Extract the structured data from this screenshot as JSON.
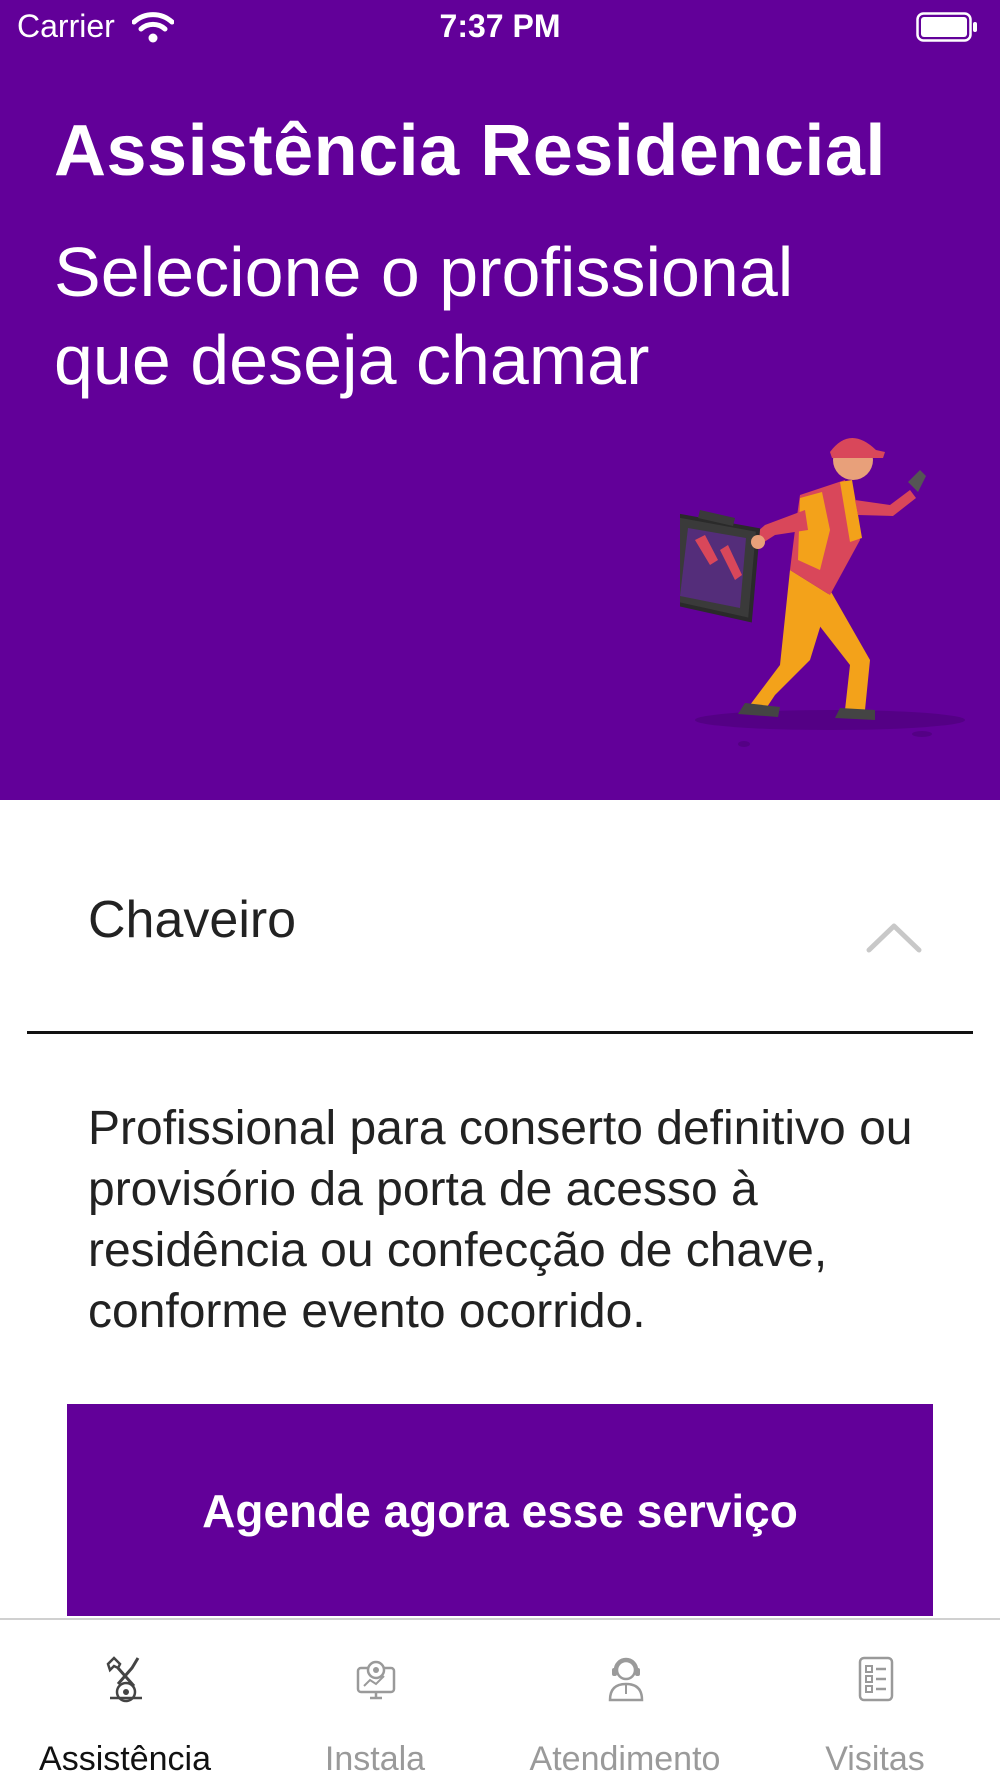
{
  "status_bar": {
    "carrier": "Carrier",
    "time": "7:37 PM"
  },
  "hero": {
    "title": "Assistência Residencial",
    "subtitle": "Selecione o profissional que deseja chamar",
    "illustration": "running-repairman-with-toolbox"
  },
  "service": {
    "name": "Chaveiro",
    "expanded": true,
    "description": "Profissional para conserto definitivo ou provisório da porta de acesso à residência ou confecção de chave, conforme evento ocorrido.",
    "cta_label": "Agende agora esse serviço"
  },
  "tabs": [
    {
      "label": "Assistência",
      "icon": "repair-tools-icon",
      "active": true
    },
    {
      "label": "Instala",
      "icon": "install-monitor-icon",
      "active": false
    },
    {
      "label": "Atendimento",
      "icon": "support-agent-icon",
      "active": false
    },
    {
      "label": "Visitas",
      "icon": "checklist-icon",
      "active": false
    }
  ],
  "colors": {
    "brand_purple": "#620099",
    "tab_active": "#111111",
    "tab_inactive": "#9a9a9a",
    "chevron": "#c8c8c8"
  }
}
